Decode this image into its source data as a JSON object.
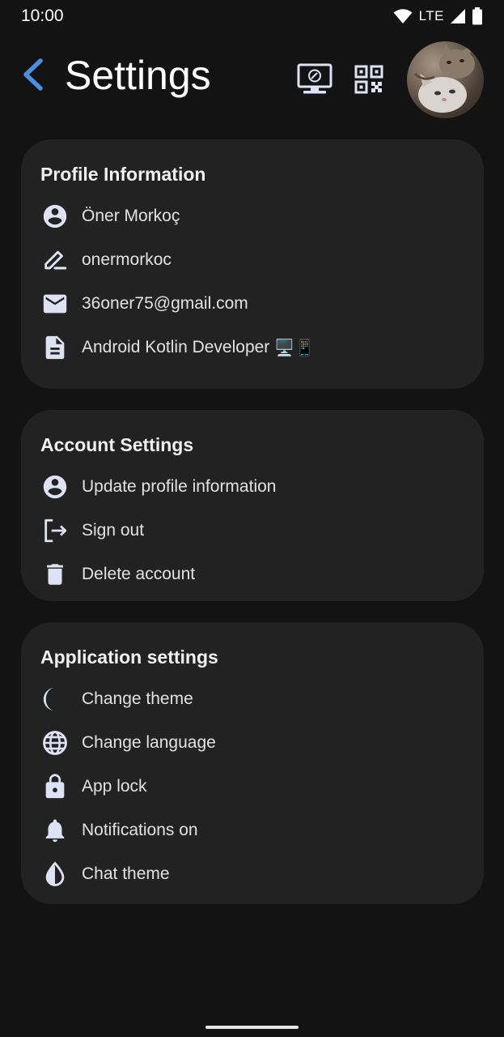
{
  "status_bar": {
    "time": "10:00",
    "network": "LTE"
  },
  "header": {
    "title": "Settings",
    "icons": [
      "back-arrow-icon",
      "monitor-icon",
      "qr-code-icon"
    ],
    "avatar": "profile-avatar-cat"
  },
  "profile_card": {
    "title": "Profile Information",
    "items": [
      {
        "icon": "account-circle-icon",
        "label": "Öner Morkoç"
      },
      {
        "icon": "edit-pen-icon",
        "label": "onermorkoc"
      },
      {
        "icon": "email-icon",
        "label": "36oner75@gmail.com"
      },
      {
        "icon": "document-icon",
        "label": "Android Kotlin Developer",
        "emoji": "🖥️📱"
      }
    ]
  },
  "account_card": {
    "title": "Account Settings",
    "items": [
      {
        "icon": "account-circle-icon",
        "label": "Update profile information"
      },
      {
        "icon": "logout-icon",
        "label": "Sign out"
      },
      {
        "icon": "trash-icon",
        "label": "Delete account"
      }
    ]
  },
  "app_card": {
    "title": "Application settings",
    "items": [
      {
        "icon": "moon-icon",
        "label": "Change theme"
      },
      {
        "icon": "globe-icon",
        "label": "Change language"
      },
      {
        "icon": "lock-icon",
        "label": "App lock"
      },
      {
        "icon": "bell-icon",
        "label": "Notifications on"
      },
      {
        "icon": "drop-icon",
        "label": "Chat theme"
      }
    ]
  },
  "colors": {
    "background": "#131313",
    "card": "#222222",
    "accent": "#4a90e2",
    "icon": "#dde3f5"
  }
}
